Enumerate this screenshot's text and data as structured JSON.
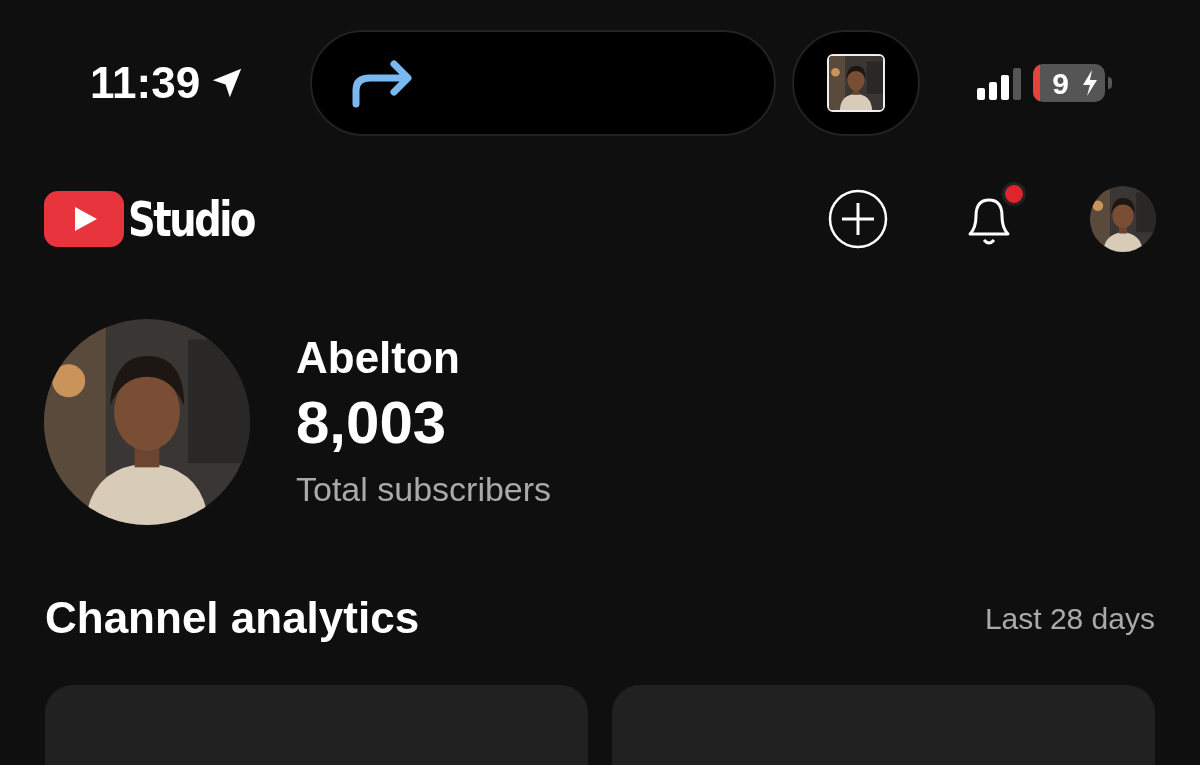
{
  "status_bar": {
    "time": "11:39",
    "battery_text": "9"
  },
  "header": {
    "logo_text": "Studio",
    "has_notification": true
  },
  "channel": {
    "name": "Abelton",
    "subscribers": "8,003",
    "subscribers_label": "Total subscribers"
  },
  "analytics": {
    "title": "Channel analytics",
    "period": "Last 28 days",
    "cards": [
      {
        "kind": "card"
      },
      {
        "kind": "card"
      }
    ]
  }
}
